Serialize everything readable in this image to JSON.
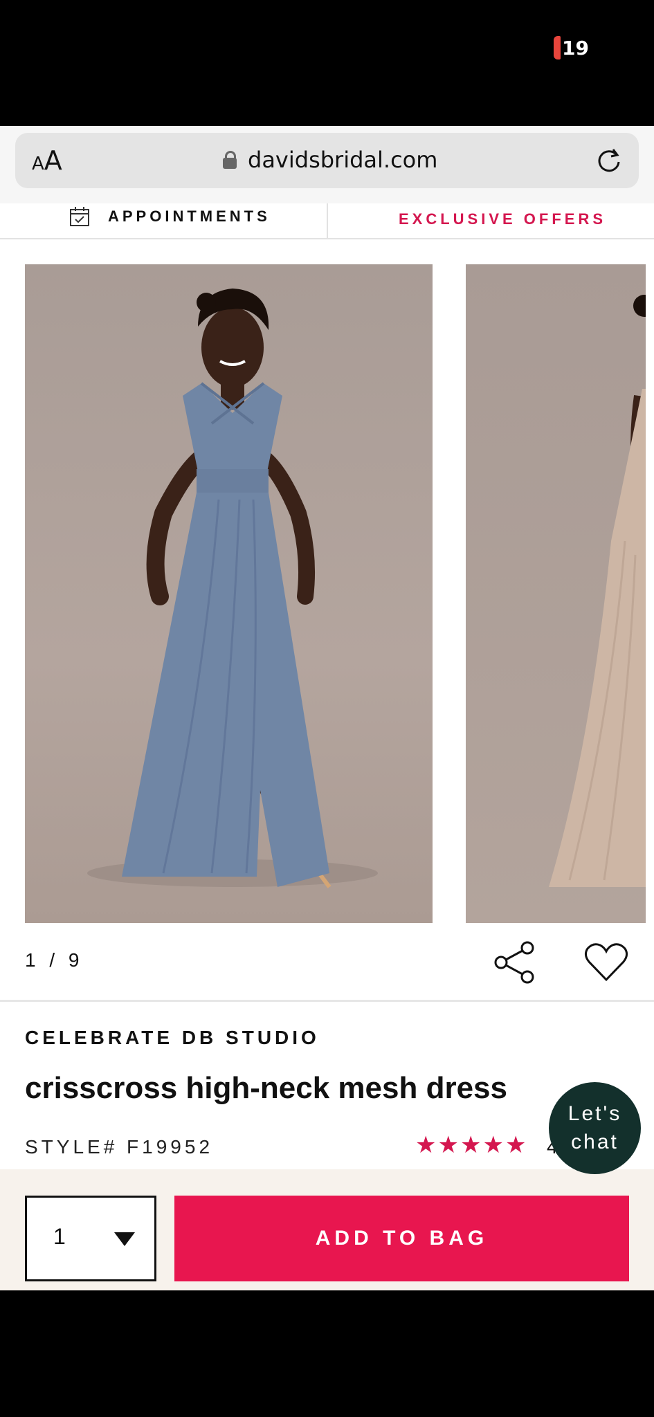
{
  "status_bar": {
    "battery": "19"
  },
  "browser": {
    "text_size_small": "A",
    "text_size_large": "A",
    "url": "davidsbridal.com"
  },
  "nav": {
    "appointments": "APPOINTMENTS",
    "offers": "EXCLUSIVE OFFERS"
  },
  "gallery": {
    "counter": "1 / 9"
  },
  "product": {
    "brand": "CELEBRATE DB STUDIO",
    "name": "crisscross high-neck mesh dress",
    "style": "STYLE# F19952",
    "rating_value": "4",
    "stars": [
      "★",
      "★",
      "★",
      "★",
      "★"
    ]
  },
  "chat": {
    "line1": "Let's",
    "line2": "chat"
  },
  "purchase": {
    "quantity": "1",
    "add_label": "ADD TO BAG"
  },
  "colors": {
    "accent": "#e8164f",
    "chat_bg": "#13302c",
    "dress": "#7086a5"
  }
}
